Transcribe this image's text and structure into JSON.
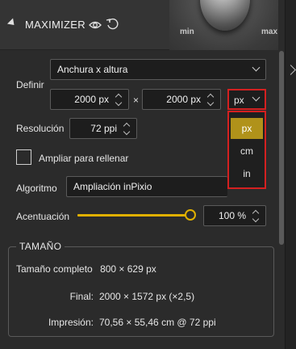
{
  "header": {
    "title": "MAXIMIZER",
    "dial_min": "min",
    "dial_max": "max"
  },
  "definir": {
    "label": "Definir",
    "mode_value": "Anchura x altura",
    "width_value": "2000 px",
    "times": "×",
    "height_value": "2000 px",
    "unit_value": "px",
    "unit_options": [
      "px",
      "cm",
      "in"
    ],
    "unit_selected": "px"
  },
  "resolucion": {
    "label": "Resolución",
    "value": "72 ppi"
  },
  "ampliar": {
    "label": "Ampliar para rellenar",
    "checked": false
  },
  "algoritmo": {
    "label": "Algoritmo",
    "value": "Ampliación inPixio"
  },
  "acentuacion": {
    "label": "Acentuación",
    "value": "100 %",
    "level": 1.0
  },
  "tamano": {
    "title": "TAMAÑO",
    "rows": [
      {
        "label": "Tamaño completo",
        "value": "800 × 629 px"
      },
      {
        "label": "Final:",
        "value": "2000 × 1572 px (×2,5)"
      },
      {
        "label": "Impresión:",
        "value": "70,56 × 55,46 cm @ 72 ppi"
      }
    ]
  },
  "colors": {
    "accent": "#e0b000",
    "selected_option": "#b0921a",
    "highlight_border": "#d42020",
    "background": "#2b2b2b"
  }
}
